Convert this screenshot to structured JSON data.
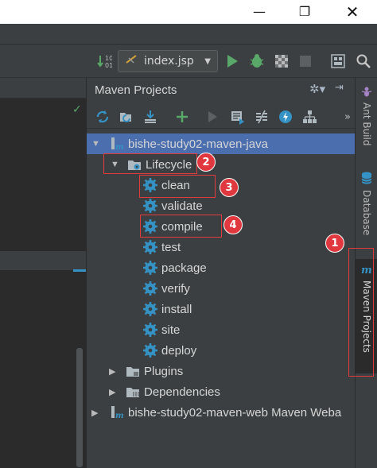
{
  "window": {
    "minimize": "—",
    "maximize": "❐",
    "close": "✕"
  },
  "toolbar": {
    "run_config": "index.jsp"
  },
  "maven": {
    "title": "Maven Projects",
    "tree": [
      {
        "label": "bishe-study02-maven-java",
        "level": 0,
        "expanded": true,
        "selected": true,
        "icon": "maven-module-icon"
      },
      {
        "label": "Lifecycle",
        "level": 1,
        "expanded": true,
        "icon": "folder-gear-icon"
      },
      {
        "label": "clean",
        "level": 2,
        "icon": "gear-icon"
      },
      {
        "label": "validate",
        "level": 2,
        "icon": "gear-icon"
      },
      {
        "label": "compile",
        "level": 2,
        "icon": "gear-icon"
      },
      {
        "label": "test",
        "level": 2,
        "icon": "gear-icon"
      },
      {
        "label": "package",
        "level": 2,
        "icon": "gear-icon"
      },
      {
        "label": "verify",
        "level": 2,
        "icon": "gear-icon"
      },
      {
        "label": "install",
        "level": 2,
        "icon": "gear-icon"
      },
      {
        "label": "site",
        "level": 2,
        "icon": "gear-icon"
      },
      {
        "label": "deploy",
        "level": 2,
        "icon": "gear-icon"
      },
      {
        "label": "Plugins",
        "level": 1,
        "expanded": false,
        "icon": "folder-plugin-icon"
      },
      {
        "label": "Dependencies",
        "level": 1,
        "expanded": false,
        "icon": "folder-deps-icon"
      },
      {
        "label": "bishe-study02-maven-web Maven Weba",
        "level": 0,
        "expanded": false,
        "icon": "maven-module-icon"
      }
    ]
  },
  "annotations": {
    "badge1": "1",
    "badge2": "2",
    "badge3": "3",
    "badge4": "4"
  },
  "sidebar": {
    "ant_build": "Ant Build",
    "database": "Database",
    "maven_projects": "Maven Projects"
  },
  "colors": {
    "accent_blue": "#4b6eaf",
    "annotation_red": "#e0383e",
    "run_green": "#59a869"
  }
}
